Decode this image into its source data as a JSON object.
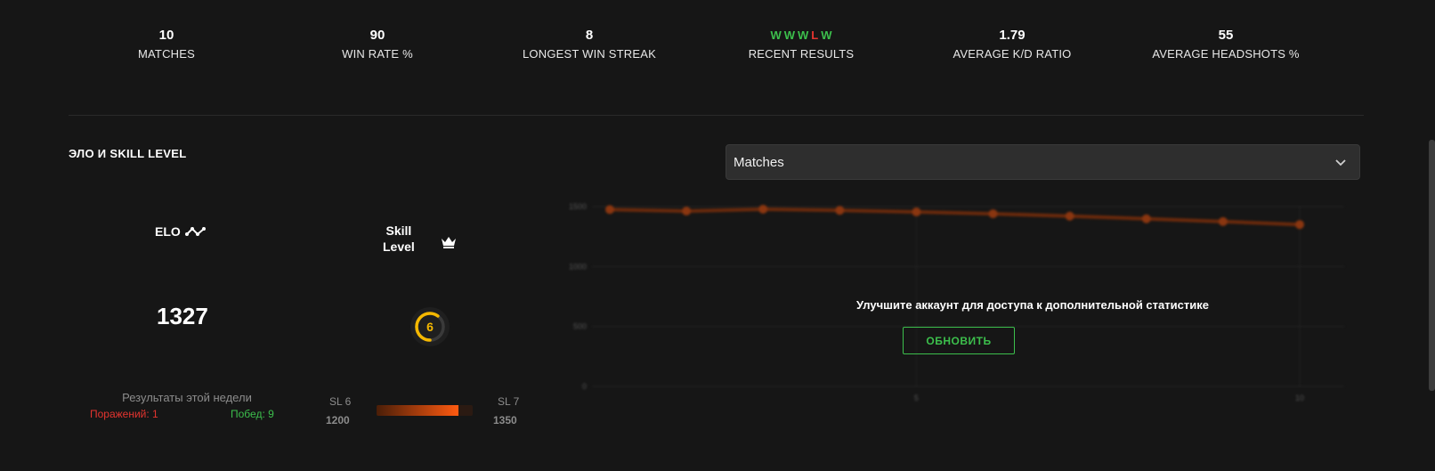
{
  "stats": [
    {
      "value": "10",
      "label": "MATCHES"
    },
    {
      "value": "90",
      "label": "WIN RATE %"
    },
    {
      "value": "8",
      "label": "LONGEST WIN STREAK"
    },
    {
      "value": "",
      "label": "RECENT RESULTS"
    },
    {
      "value": "1.79",
      "label": "AVERAGE K/D RATIO"
    },
    {
      "value": "55",
      "label": "AVERAGE HEADSHOTS %"
    }
  ],
  "recent_results": [
    "W",
    "W",
    "W",
    "L",
    "W"
  ],
  "colors": {
    "win": "#3cbf4c",
    "loss": "#e4342f",
    "accent": "#ff5a10",
    "level": "#f5b800"
  },
  "section": {
    "title": "ЭЛО И SKILL LEVEL"
  },
  "elo": {
    "label": "ELO",
    "value": "1327"
  },
  "skill": {
    "label_line1": "Skill",
    "label_line2": "Level",
    "level": "6",
    "level_progress": 0.6
  },
  "week": {
    "title": "Результаты этой недели",
    "losses": "Поражений: 1",
    "wins": "Побед: 9"
  },
  "sl_progress": {
    "left_label": "SL 6",
    "right_label": "SL 7",
    "left_value": "1200",
    "right_value": "1350",
    "fill": 0.85
  },
  "select": {
    "value": "Matches"
  },
  "upgrade": {
    "text": "Улучшите аккаунт для доступа к дополнительной статистике",
    "button": "ОБНОВИТЬ"
  },
  "icons": {
    "elo": "elo-graph-icon",
    "skill": "crown-icon",
    "select": "chevron-down-icon"
  },
  "chart_data": {
    "type": "line",
    "x": [
      1,
      2,
      3,
      4,
      5,
      6,
      7,
      8,
      9,
      10
    ],
    "series": [
      {
        "values": [
          1475,
          1462,
          1478,
          1468,
          1455,
          1440,
          1420,
          1398,
          1375,
          1350
        ]
      }
    ],
    "ylim": [
      0,
      1500
    ],
    "yticks": [
      "1500",
      "1000",
      "500",
      "0"
    ],
    "xticks": [
      "5",
      "10"
    ],
    "grid": true,
    "blurred": true
  }
}
